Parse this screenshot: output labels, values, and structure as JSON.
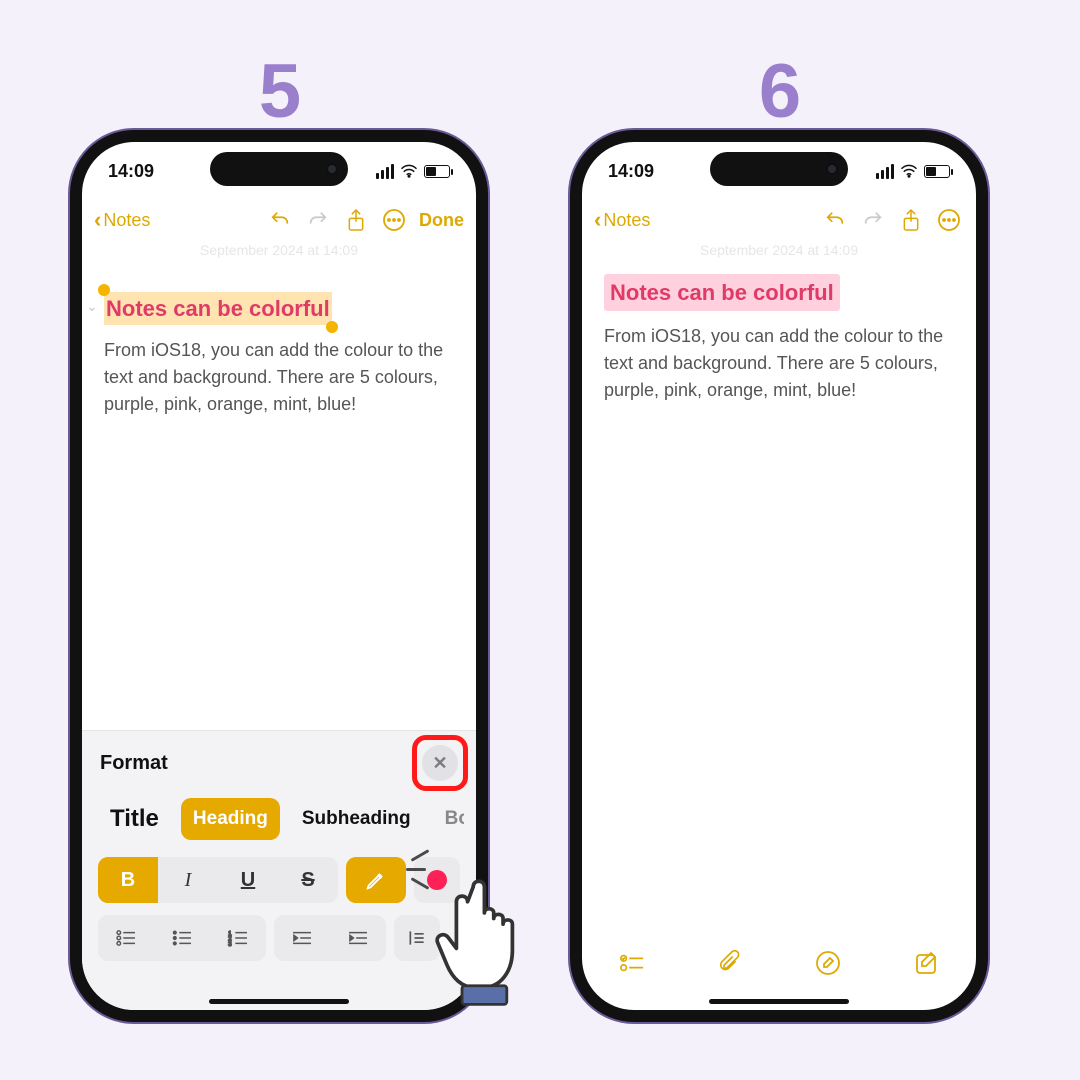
{
  "steps": {
    "left": "5",
    "right": "6"
  },
  "status": {
    "time": "14:09"
  },
  "nav": {
    "back": "Notes",
    "done": "Done"
  },
  "note": {
    "date": "September 2024 at 14:09",
    "heading": "Notes can be colorful",
    "body": "From iOS18, you can add the colour to the text and background. There are 5 colours, purple, pink, orange, mint, blue!"
  },
  "format": {
    "title": "Format",
    "styles": {
      "title": "Title",
      "heading": "Heading",
      "subheading": "Subheading",
      "body": "Body"
    },
    "bold": "B",
    "italic": "I",
    "underline": "U",
    "strike": "S"
  },
  "colors": {
    "accent": "#dda900",
    "highlight_pink_bg": "#ffd0dd",
    "heading_text": "#e03a68",
    "selection_bg": "#ffe3b0",
    "step_number": "#9a7fcd",
    "callout_ring": "#ff1a1a",
    "color_swatch": "#ff2156"
  },
  "icons": {
    "undo": "undo-icon",
    "redo": "redo-icon",
    "share": "share-icon",
    "more": "more-icon",
    "close": "close-icon",
    "pencil": "pencil-icon",
    "checklist": "checklist-icon",
    "attachment": "attachment-icon",
    "draw": "draw-icon",
    "compose": "compose-icon"
  }
}
